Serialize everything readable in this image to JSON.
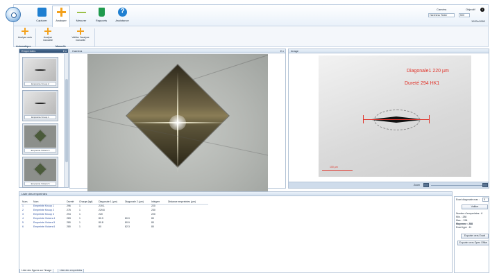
{
  "ribbon": {
    "tabs": [
      {
        "label": "Capturer",
        "icon": "camera-icon"
      },
      {
        "label": "Analyser",
        "icon": "analyse-icon"
      },
      {
        "label": "Mesurer",
        "icon": "measure-icon"
      },
      {
        "label": "Rapports",
        "icon": "report-icon"
      },
      {
        "label": "Assistance",
        "icon": "help-icon"
      }
    ],
    "active_tab": "Analyser",
    "buttons": [
      {
        "label": "Analyse auto"
      },
      {
        "label": "Analyse manuelle"
      },
      {
        "label": "Valider l'analyse manuelle"
      }
    ],
    "groups": [
      "Automatique",
      "Manuelle"
    ],
    "camera_label": "Caméra",
    "camera_value": "Hardness Tester",
    "objective_label": "Objectif",
    "objective_value": "50X",
    "resolution": "1920x1080",
    "info_symbol": "i"
  },
  "panels": {
    "thumbs_title": "Empreintes",
    "camera_title": "Caméra",
    "image_title": "Image",
    "list_title": "Liste des empreintes",
    "panel_controls": "▾ x"
  },
  "thumbnails": [
    {
      "label": "Empreinte Knoop 2"
    },
    {
      "label": "Empreinte Knoop 1"
    },
    {
      "label": "Empreinte Vickers 6"
    },
    {
      "label": "Empreinte Vickers 5"
    }
  ],
  "image_overlay": {
    "diagonal_text": "Diagonale1 220 µm",
    "hardness_text": "Dureté 294 HK1",
    "scale_text": "100 µm"
  },
  "zoom": {
    "label": "Zoom"
  },
  "table": {
    "headers": [
      "Num.",
      "Nom",
      "Dureté",
      "Charge (kgf)",
      "Diagonale 1 (µm)",
      "Diagonale 2 (µm)",
      "Intégrer",
      "Distance empreintes (µm)"
    ],
    "rows": [
      [
        "1",
        "Empreinte Knoop 1",
        "296",
        "1",
        "219.1",
        "",
        "220",
        ""
      ],
      [
        "2",
        "Empreinte Knoop 2",
        "275",
        "1",
        "229.8",
        "",
        "230",
        ""
      ],
      [
        "3",
        "Empreinte Knoop 3",
        "294",
        "1",
        "220",
        "",
        "220",
        ""
      ],
      [
        "4",
        "Empreinte Vickers 4",
        "283",
        "1",
        "80.9",
        "80.9",
        "80",
        ""
      ],
      [
        "5",
        "Empreinte Vickers 5",
        "280",
        "1",
        "80.8",
        "80.9",
        "80",
        ""
      ],
      [
        "6",
        "Empreinte Vickers 6",
        "280",
        "1",
        "80",
        "82.3",
        "80",
        ""
      ]
    ]
  },
  "side": {
    "max_diag_label": "Ecart diagonale max :",
    "max_diag_value": "5",
    "validate_btn": "Valider",
    "count_line": "Nombre d'empreintes : 6",
    "min_line": "Min. : 280",
    "max_line": "Max. : 296",
    "avg_line": "Moyenne : 288",
    "std_line": "Ecart type : 11",
    "export_excel": "Exporter vers Excel",
    "export_openoffice": "Exporter vers Open Office"
  },
  "bottom_tabs": [
    "Liste des figures sur l'image",
    "Liste des empreintes"
  ]
}
